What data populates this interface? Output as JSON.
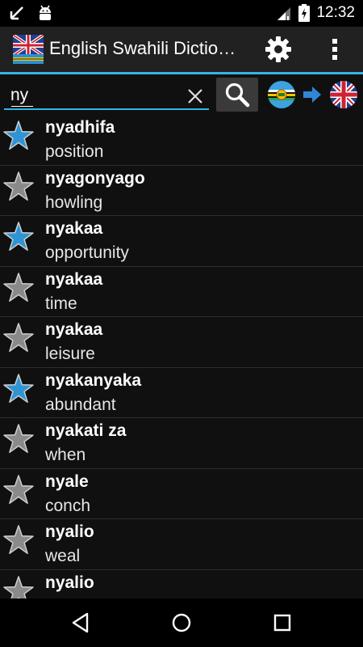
{
  "status_bar": {
    "time": "12:32",
    "icons": [
      "missed-call-icon",
      "android-debug-icon",
      "signal-icon",
      "battery-icon"
    ]
  },
  "app_bar": {
    "title": "English Swahili Dictio…",
    "icon": "uk-flag-icon",
    "actions": [
      "settings-icon",
      "overflow-menu-icon"
    ]
  },
  "search": {
    "value": "ny",
    "placeholder": "",
    "clear_icon": "close-icon",
    "search_icon": "search-icon",
    "from_language_icon": "east-africa-flag-icon",
    "direction_icon": "arrow-right-icon",
    "to_language_icon": "uk-flag-icon"
  },
  "colors": {
    "accent": "#33b5e5",
    "star_favorite": "#2f94d4",
    "star_default": "#8a8a8a",
    "background": "#101010",
    "action_bar": "#212121"
  },
  "words": [
    {
      "term": "nyadhifa",
      "translation": "position",
      "favorite": true
    },
    {
      "term": "nyagonyago",
      "translation": "howling",
      "favorite": false
    },
    {
      "term": "nyakaa",
      "translation": "opportunity",
      "favorite": true
    },
    {
      "term": "nyakaa",
      "translation": "time",
      "favorite": false
    },
    {
      "term": "nyakaa",
      "translation": "leisure",
      "favorite": false
    },
    {
      "term": "nyakanyaka",
      "translation": "abundant",
      "favorite": true
    },
    {
      "term": "nyakati za",
      "translation": "when",
      "favorite": false
    },
    {
      "term": "nyale",
      "translation": "conch",
      "favorite": false
    },
    {
      "term": "nyalio",
      "translation": "weal",
      "favorite": false
    },
    {
      "term": "nyalio",
      "translation": "",
      "favorite": false
    }
  ],
  "nav_bar": {
    "buttons": [
      "back-icon",
      "home-icon",
      "recents-icon"
    ]
  }
}
